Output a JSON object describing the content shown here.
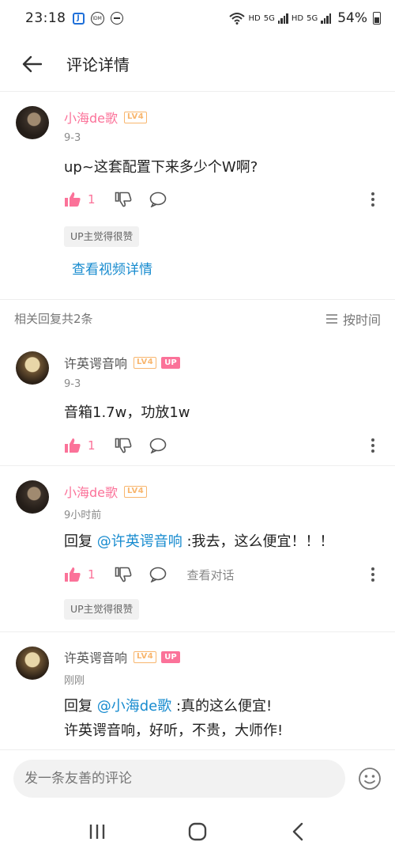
{
  "status_bar": {
    "time": "23:18",
    "app_icon_1": "J",
    "app_icon_2": "IDM",
    "network_1": "HD",
    "network_2": "5G",
    "network_3": "HD",
    "network_4": "5G",
    "battery": "54%"
  },
  "header": {
    "title": "评论详情"
  },
  "main_comment": {
    "username": "小海de歌",
    "level": "LV4",
    "time": "9-3",
    "text": "up~这套配置下来多少个W啊?",
    "likes": "1",
    "up_liked": "UP主觉得很赞",
    "video_link": "查看视频详情"
  },
  "replies_bar": {
    "count_text": "相关回复共2条",
    "sort_label": "按时间"
  },
  "replies": [
    {
      "username": "许英谔音响",
      "level": "LV4",
      "up_tag": "UP",
      "time": "9-3",
      "text": "音箱1.7w，功放1w",
      "likes": "1"
    },
    {
      "username": "小海de歌",
      "level": "LV4",
      "time": "9小时前",
      "reply_prefix": "回复 ",
      "mention": "@许英谔音响",
      "text": " :我去，这么便宜！！！",
      "likes": "1",
      "view_conversation": "查看对话",
      "up_liked": "UP主觉得很赞"
    },
    {
      "username": "许英谔音响",
      "level": "LV4",
      "up_tag": "UP",
      "time": "刚刚",
      "reply_prefix": "回复 ",
      "mention": "@小海de歌",
      "text": " :真的这么便宜!",
      "text_line2": "许英谔音响，好听，不贵，大师作!"
    }
  ],
  "input": {
    "placeholder": "发一条友善的评论"
  },
  "colors": {
    "accent_pink": "#fb7299",
    "link_blue": "#178bcf",
    "level_orange": "#f8b66e"
  }
}
